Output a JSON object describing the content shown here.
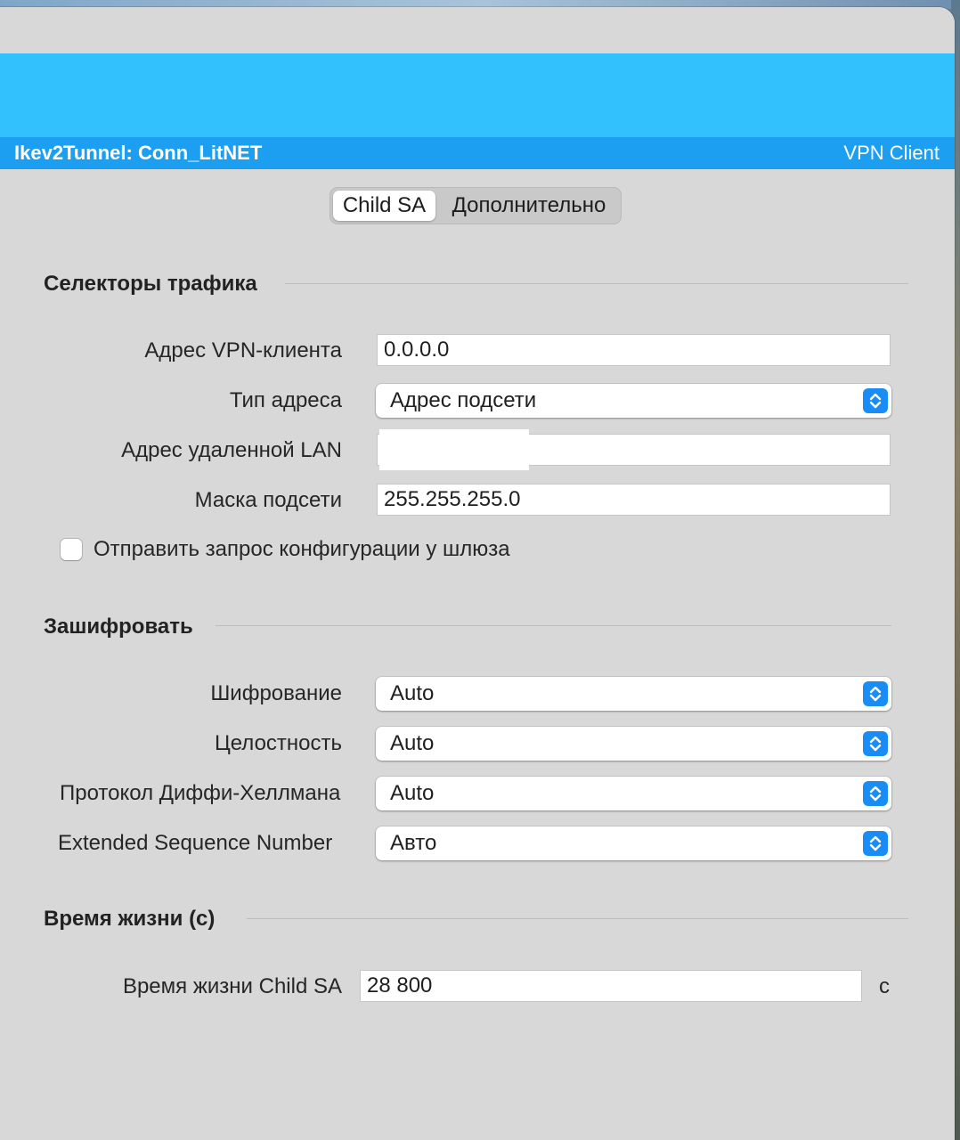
{
  "header": {
    "path_title": "Ikev2Tunnel: Conn_LitNET",
    "module_name": "VPN Client"
  },
  "tabs": [
    {
      "label": "Child SA",
      "active": true
    },
    {
      "label": "Дополнительно",
      "active": false
    }
  ],
  "traffic_selectors": {
    "title": "Селекторы трафика",
    "vpn_client_address": {
      "label": "Адрес VPN-клиента",
      "value": "0.0.0.0"
    },
    "address_type": {
      "label": "Тип адреса",
      "value": "Адрес подсети"
    },
    "remote_lan_address": {
      "label": "Адрес удаленной LAN",
      "value": ""
    },
    "subnet_mask": {
      "label": "Маска подсети",
      "value": "255.255.255.0"
    },
    "request_config": {
      "label": "Отправить запрос конфигурации у шлюза",
      "checked": false
    }
  },
  "encryption": {
    "title": "Зашифровать",
    "cipher": {
      "label": "Шифрование",
      "value": "Auto"
    },
    "integrity": {
      "label": "Целостность",
      "value": "Auto"
    },
    "dh_group": {
      "label": "Протокол Диффи-Хеллмана",
      "value": "Auto"
    },
    "esn": {
      "label": "Extended Sequence Number",
      "value": "Авто"
    }
  },
  "lifetime": {
    "title": "Время жизни (с)",
    "child_sa": {
      "label": "Время жизни Child SA",
      "value": "28 800",
      "unit": "с"
    }
  },
  "colors": {
    "banner": "#33c1fe",
    "pathbar": "#1c9ff0",
    "accent": "#1a8cf5"
  }
}
